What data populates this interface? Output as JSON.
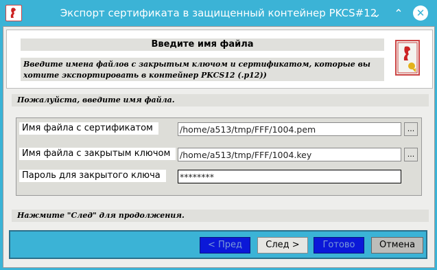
{
  "window": {
    "title": "Экспорт сертификата в защищенный контейнер PKCS#12"
  },
  "header": {
    "title": "Введите имя файла",
    "description": "Введите имена файлов с закрытым ключом и сертификатом, которые вы хотите экспортировать в контейнер PKCS12 (.p12))"
  },
  "hint_top": "Пожалуйста, введите имя файла.",
  "form": {
    "cert_label": "Имя файла с сертификатом",
    "cert_value": "/home/a513/tmp/FFF/1004.pem",
    "key_label": "Имя файла с закрытым ключом",
    "key_value": "/home/a513/tmp/FFF/1004.key",
    "pass_label": "Пароль для закрытого ключа",
    "pass_value": "********",
    "browse": "..."
  },
  "hint_bottom": "Нажмите \"След\" для продолжения.",
  "buttons": {
    "prev": "< Пред",
    "next": "След >",
    "finish": "Готово",
    "cancel": "Отмена"
  }
}
